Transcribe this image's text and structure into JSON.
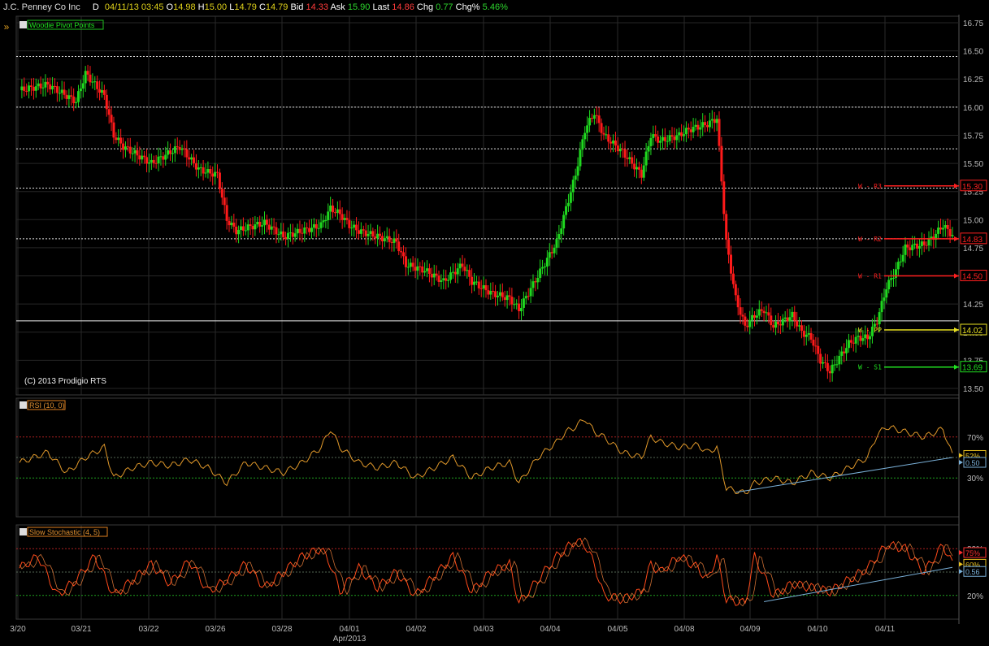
{
  "header": {
    "name": "J.C. Penney Co Inc",
    "period": "D",
    "datetime": "04/11/13 03:45",
    "open_label": "O",
    "open": "14.98",
    "high_label": "H",
    "high": "15.00",
    "low_label": "L",
    "low": "14.79",
    "close_label": "C",
    "close": "14.79",
    "bid_label": "Bid",
    "bid": "14.33",
    "ask_label": "Ask",
    "ask": "15.90",
    "last_label": "Last",
    "last": "14.86",
    "chg_label": "Chg",
    "chg": "0.77",
    "chgpct_label": "Chg%",
    "chgpct": "5.46%"
  },
  "side_tab_glyph": "»",
  "colors": {
    "up": "#1fd81f",
    "down": "#ff1a1a",
    "rsi": "#e0982a",
    "stoch": "#ff4a1a",
    "pivot_r": "#ff2020",
    "pivot_pp": "#e8e020",
    "pivot_s": "#20e020",
    "trend": "#7ab0d8"
  },
  "chart_data": [
    {
      "type": "candlestick",
      "legend": "Woodie Pivot Points",
      "copyright": "(C) 2013 Prodigio RTS",
      "ylim": [
        13.5,
        16.75
      ],
      "y_ticks": [
        "16.75",
        "16.50",
        "16.25",
        "16.00",
        "15.75",
        "15.50",
        "15.25",
        "15.00",
        "14.75",
        "14.50",
        "14.25",
        "14.00",
        "13.75",
        "13.50"
      ],
      "x_ticks": [
        "3/20",
        "03/21",
        "03/22",
        "03/26",
        "03/28",
        "04/01",
        "04/02",
        "04/03",
        "04/04",
        "04/05",
        "04/08",
        "04/09",
        "04/10",
        "04/11"
      ],
      "x_month_label": "Apr/2013",
      "pivots": [
        {
          "label": "W - R3",
          "value": "15.30",
          "kind": "r"
        },
        {
          "label": "W - R2",
          "value": "14.83",
          "kind": "r"
        },
        {
          "label": "W - R1",
          "value": "14.50",
          "kind": "r"
        },
        {
          "label": "W - PP",
          "value": "14.02",
          "kind": "pp"
        },
        {
          "label": "W - S1",
          "value": "13.69",
          "kind": "s"
        }
      ],
      "hlines_white": [
        16.45,
        16.0,
        15.63,
        15.28,
        14.83
      ],
      "hline_yellow": 14.1,
      "close_path": [
        [
          0,
          16.15
        ],
        [
          3,
          16.2
        ],
        [
          6,
          16.05
        ],
        [
          7,
          16.3
        ],
        [
          9,
          16.1
        ],
        [
          10,
          15.75
        ],
        [
          11,
          15.65
        ],
        [
          13,
          15.55
        ],
        [
          14,
          15.5
        ],
        [
          15,
          15.55
        ],
        [
          16,
          15.6
        ],
        [
          17,
          15.65
        ],
        [
          18,
          15.55
        ],
        [
          19,
          15.45
        ],
        [
          20,
          15.42
        ],
        [
          21,
          15.4
        ],
        [
          22,
          15.0
        ],
        [
          23,
          14.9
        ],
        [
          25,
          14.95
        ],
        [
          26,
          14.97
        ],
        [
          28,
          14.85
        ],
        [
          30,
          14.9
        ],
        [
          32,
          14.95
        ],
        [
          33,
          15.1
        ],
        [
          34,
          15.05
        ],
        [
          35,
          14.95
        ],
        [
          36,
          14.9
        ],
        [
          38,
          14.85
        ],
        [
          40,
          14.8
        ],
        [
          41,
          14.6
        ],
        [
          43,
          14.55
        ],
        [
          45,
          14.45
        ],
        [
          47,
          14.6
        ],
        [
          48,
          14.45
        ],
        [
          50,
          14.35
        ],
        [
          52,
          14.3
        ],
        [
          53,
          14.2
        ],
        [
          55,
          14.5
        ],
        [
          57,
          14.8
        ],
        [
          58,
          15.1
        ],
        [
          59,
          15.4
        ],
        [
          60,
          15.8
        ],
        [
          61,
          15.95
        ],
        [
          62,
          15.75
        ],
        [
          64,
          15.6
        ],
        [
          65,
          15.5
        ],
        [
          66,
          15.4
        ],
        [
          67,
          15.75
        ],
        [
          68,
          15.7
        ],
        [
          70,
          15.75
        ],
        [
          71,
          15.8
        ],
        [
          73,
          15.85
        ],
        [
          74,
          15.9
        ],
        [
          75,
          14.8
        ],
        [
          76,
          14.3
        ],
        [
          77,
          14.05
        ],
        [
          78,
          14.15
        ],
        [
          79,
          14.2
        ],
        [
          80,
          14.05
        ],
        [
          82,
          14.15
        ],
        [
          83,
          14.0
        ],
        [
          84,
          13.95
        ],
        [
          85,
          13.75
        ],
        [
          86,
          13.65
        ],
        [
          88,
          13.9
        ],
        [
          89,
          13.95
        ],
        [
          90,
          13.95
        ],
        [
          91,
          14.1
        ],
        [
          92,
          14.4
        ],
        [
          93,
          14.55
        ],
        [
          94,
          14.75
        ],
        [
          96,
          14.78
        ],
        [
          97,
          14.85
        ],
        [
          98,
          14.95
        ],
        [
          99,
          14.86
        ]
      ],
      "n_bars": 100
    },
    {
      "type": "line",
      "legend": "RSI (10, 0)",
      "ylim": [
        0,
        100
      ],
      "y_ticks": [
        "70%",
        "30%"
      ],
      "levels": [
        70,
        50,
        30
      ],
      "markers": [
        {
          "value": "52%",
          "y": 52
        },
        {
          "value": "0.50",
          "y": 50
        }
      ],
      "series_path": [
        [
          0,
          45
        ],
        [
          3,
          55
        ],
        [
          5,
          35
        ],
        [
          7,
          50
        ],
        [
          9,
          60
        ],
        [
          10,
          30
        ],
        [
          12,
          40
        ],
        [
          14,
          45
        ],
        [
          16,
          42
        ],
        [
          18,
          48
        ],
        [
          20,
          40
        ],
        [
          22,
          25
        ],
        [
          24,
          45
        ],
        [
          26,
          40
        ],
        [
          28,
          35
        ],
        [
          30,
          45
        ],
        [
          32,
          60
        ],
        [
          33,
          78
        ],
        [
          34,
          60
        ],
        [
          36,
          45
        ],
        [
          38,
          40
        ],
        [
          40,
          45
        ],
        [
          42,
          30
        ],
        [
          44,
          40
        ],
        [
          46,
          50
        ],
        [
          48,
          30
        ],
        [
          50,
          40
        ],
        [
          52,
          45
        ],
        [
          53,
          25
        ],
        [
          55,
          50
        ],
        [
          57,
          65
        ],
        [
          58,
          75
        ],
        [
          59,
          80
        ],
        [
          60,
          88
        ],
        [
          61,
          75
        ],
        [
          62,
          70
        ],
        [
          64,
          55
        ],
        [
          66,
          50
        ],
        [
          67,
          70
        ],
        [
          68,
          65
        ],
        [
          70,
          60
        ],
        [
          72,
          62
        ],
        [
          73,
          55
        ],
        [
          74,
          60
        ],
        [
          75,
          20
        ],
        [
          77,
          15
        ],
        [
          78,
          25
        ],
        [
          80,
          30
        ],
        [
          82,
          25
        ],
        [
          84,
          35
        ],
        [
          86,
          30
        ],
        [
          88,
          40
        ],
        [
          90,
          50
        ],
        [
          91,
          72
        ],
        [
          92,
          80
        ],
        [
          94,
          75
        ],
        [
          96,
          70
        ],
        [
          98,
          78
        ],
        [
          99,
          52
        ]
      ],
      "trend": [
        [
          76,
          16
        ],
        [
          99,
          50
        ]
      ]
    },
    {
      "type": "line",
      "legend": "Slow Stochastic (4, 5)",
      "ylim": [
        0,
        100
      ],
      "y_ticks": [
        "80%",
        "20%"
      ],
      "levels": [
        80,
        50,
        20
      ],
      "markers": [
        {
          "value": "75%",
          "y": 75
        },
        {
          "value": "60%",
          "y": 60
        },
        {
          "value": "0.56",
          "y": 56
        }
      ],
      "series_path": [
        [
          0,
          55
        ],
        [
          2,
          70
        ],
        [
          4,
          20
        ],
        [
          6,
          40
        ],
        [
          8,
          70
        ],
        [
          10,
          20
        ],
        [
          12,
          40
        ],
        [
          14,
          60
        ],
        [
          16,
          35
        ],
        [
          18,
          65
        ],
        [
          20,
          25
        ],
        [
          22,
          40
        ],
        [
          24,
          60
        ],
        [
          26,
          30
        ],
        [
          28,
          50
        ],
        [
          30,
          70
        ],
        [
          32,
          80
        ],
        [
          33,
          60
        ],
        [
          34,
          25
        ],
        [
          36,
          55
        ],
        [
          38,
          30
        ],
        [
          40,
          50
        ],
        [
          42,
          20
        ],
        [
          44,
          45
        ],
        [
          46,
          70
        ],
        [
          48,
          25
        ],
        [
          50,
          50
        ],
        [
          52,
          60
        ],
        [
          53,
          10
        ],
        [
          55,
          40
        ],
        [
          57,
          70
        ],
        [
          58,
          80
        ],
        [
          59,
          90
        ],
        [
          60,
          85
        ],
        [
          61,
          60
        ],
        [
          62,
          20
        ],
        [
          64,
          15
        ],
        [
          66,
          25
        ],
        [
          67,
          60
        ],
        [
          68,
          50
        ],
        [
          70,
          70
        ],
        [
          72,
          55
        ],
        [
          73,
          40
        ],
        [
          74,
          70
        ],
        [
          75,
          15
        ],
        [
          77,
          10
        ],
        [
          78,
          70
        ],
        [
          80,
          20
        ],
        [
          82,
          35
        ],
        [
          84,
          30
        ],
        [
          86,
          25
        ],
        [
          88,
          40
        ],
        [
          90,
          55
        ],
        [
          91,
          70
        ],
        [
          92,
          85
        ],
        [
          94,
          80
        ],
        [
          96,
          50
        ],
        [
          98,
          85
        ],
        [
          99,
          60
        ]
      ],
      "trend": [
        [
          79,
          12
        ],
        [
          99,
          56
        ]
      ]
    }
  ]
}
